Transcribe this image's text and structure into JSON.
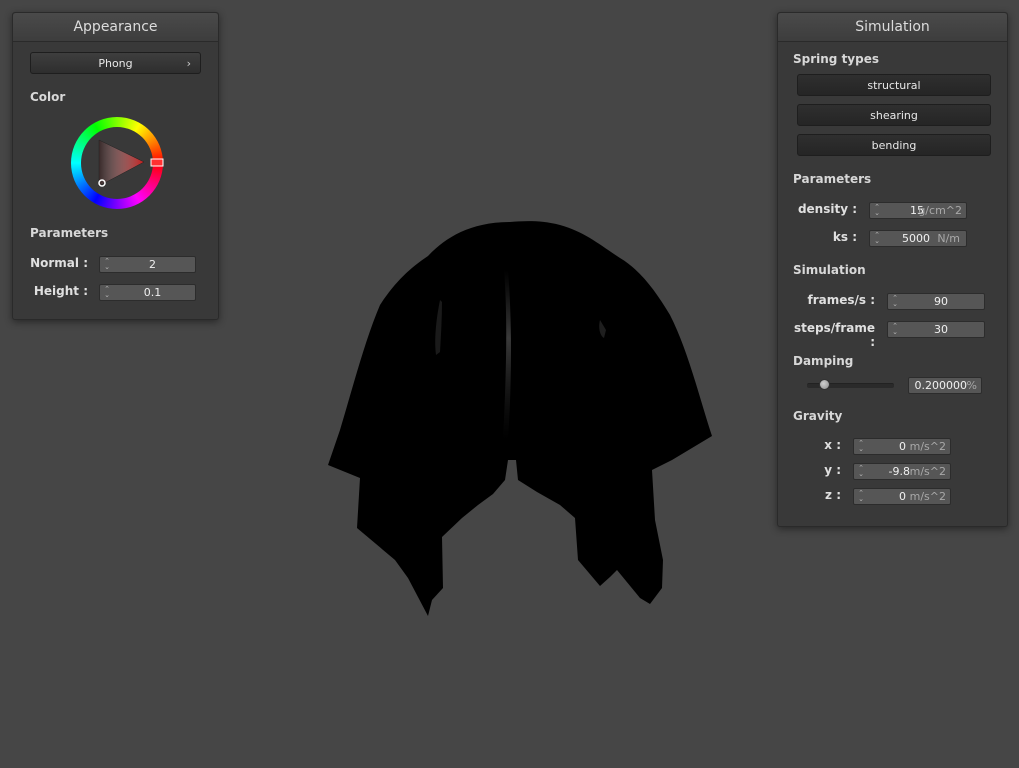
{
  "appearance": {
    "title": "Appearance",
    "shader": {
      "selected": "Phong",
      "chevron": "›"
    },
    "color_label": "Color",
    "color_picker": {
      "hue_marker_color": "#ff3030",
      "triangle_color": "#cc1a1a"
    },
    "parameters_label": "Parameters",
    "normal": {
      "label": "Normal :",
      "value": "2"
    },
    "height": {
      "label": "Height :",
      "value": "0.1"
    }
  },
  "simulation_panel": {
    "title": "Simulation",
    "spring_types_label": "Spring types",
    "spring_types": [
      "structural",
      "shearing",
      "bending"
    ],
    "parameters_label": "Parameters",
    "density": {
      "label": "density :",
      "value": "15",
      "unit": "g/cm^2"
    },
    "ks": {
      "label": "ks :",
      "value": "5000",
      "unit": "N/m"
    },
    "simulation_label": "Simulation",
    "fps": {
      "label": "frames/s :",
      "value": "90"
    },
    "steps": {
      "label": "steps/frame :",
      "value": "30"
    },
    "damping_label": "Damping",
    "damping": {
      "value": "0.200000",
      "unit": "%",
      "level": 0.2
    },
    "gravity_label": "Gravity",
    "gravity": {
      "x": {
        "label": "x :",
        "value": "0",
        "unit": "m/s^2"
      },
      "y": {
        "label": "y :",
        "value": "-9.8",
        "unit": "m/s^2"
      },
      "z": {
        "label": "z :",
        "value": "0",
        "unit": "m/s^2"
      }
    }
  },
  "scene": {
    "background": "#464646",
    "cloth_color": "#000000"
  }
}
